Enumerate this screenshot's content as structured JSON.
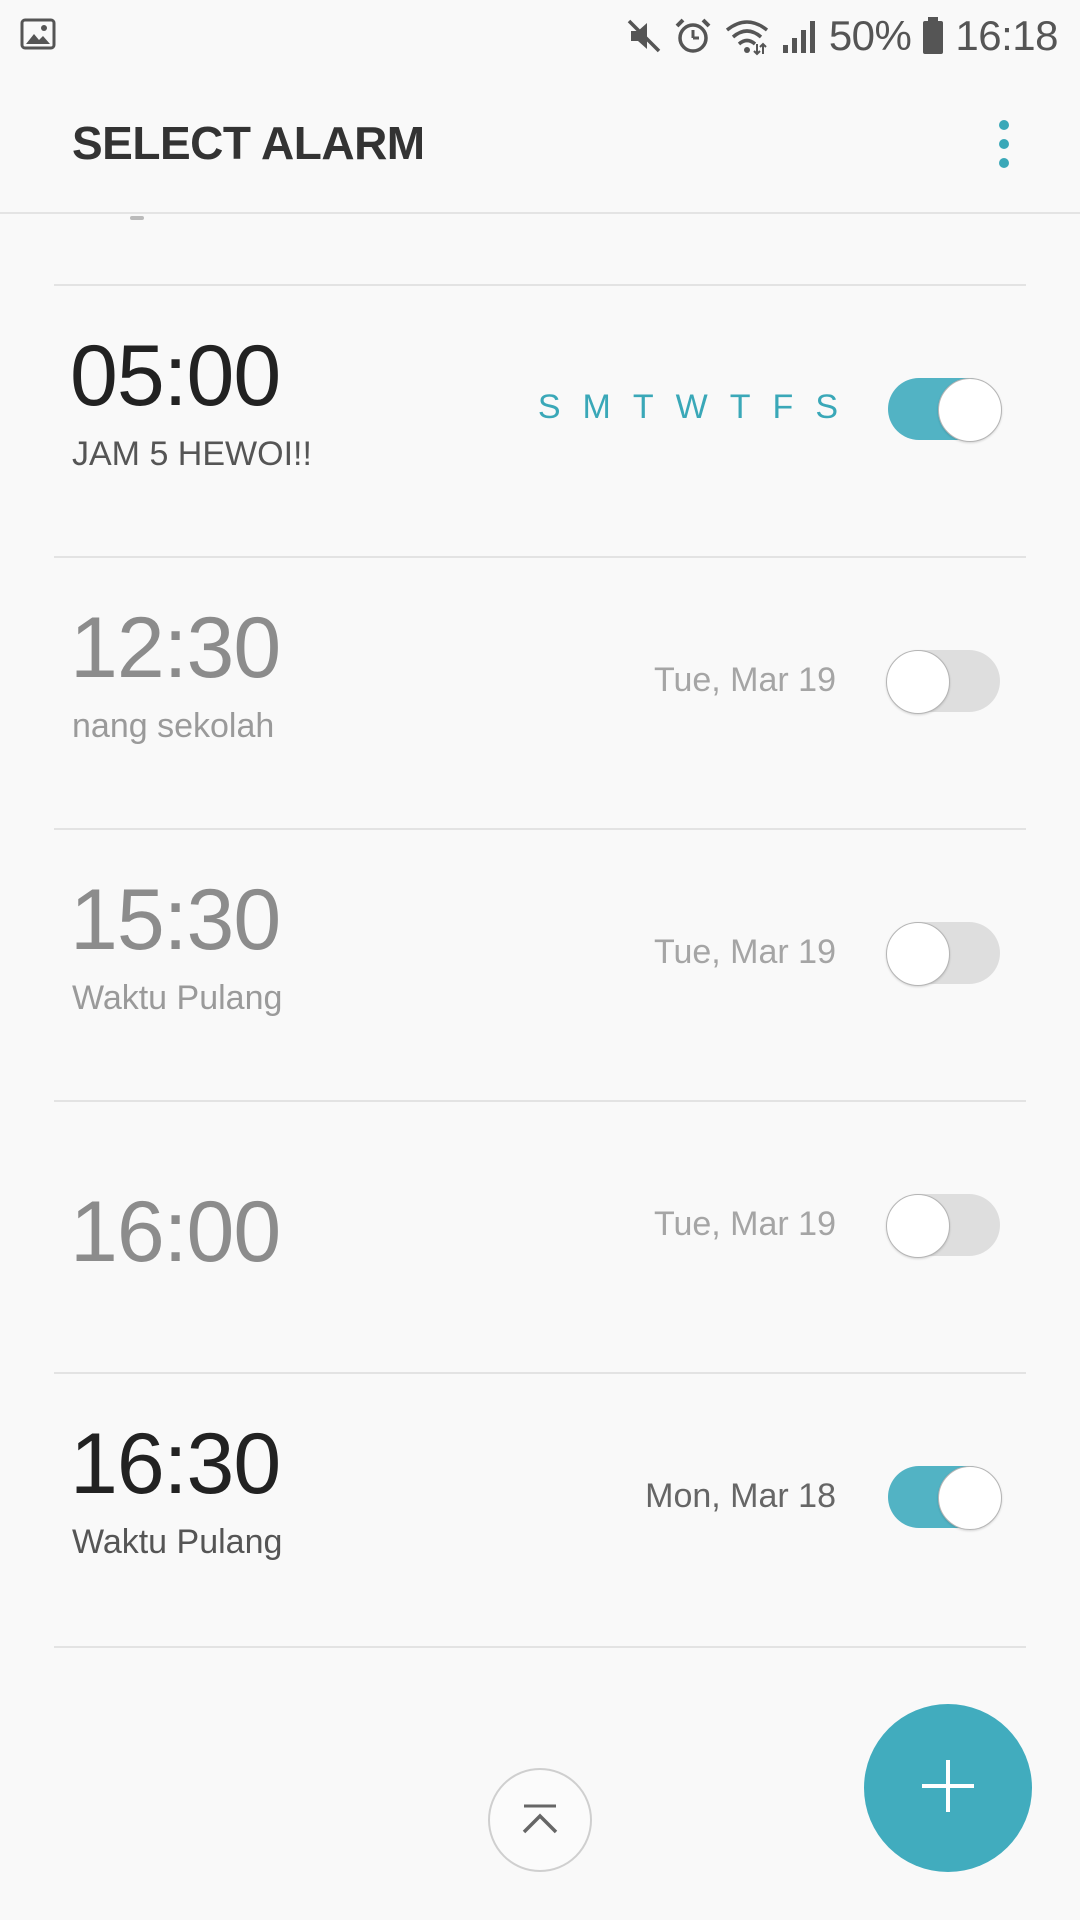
{
  "status_bar": {
    "battery_percent": "50%",
    "time": "16:18",
    "icons": [
      "gallery-icon",
      "mute-icon",
      "alarm-clock-icon",
      "wifi-icon",
      "signal-icon",
      "battery-icon"
    ]
  },
  "app_bar": {
    "title": "SELECT ALARM",
    "menu_icon": "more-vert-icon"
  },
  "alarms": [
    {
      "time": "05:00",
      "label": "JAM 5 HEWOI!!",
      "repeat_days": [
        "S",
        "M",
        "T",
        "W",
        "T",
        "F",
        "S"
      ],
      "date": "",
      "enabled": true
    },
    {
      "time": "12:30",
      "label": "nang sekolah",
      "repeat_days": [],
      "date": "Tue, Mar 19",
      "enabled": false
    },
    {
      "time": "15:30",
      "label": "Waktu Pulang",
      "repeat_days": [],
      "date": "Tue, Mar 19",
      "enabled": false
    },
    {
      "time": "16:00",
      "label": "",
      "repeat_days": [],
      "date": "Tue, Mar 19",
      "enabled": false
    },
    {
      "time": "16:30",
      "label": "Waktu Pulang",
      "repeat_days": [],
      "date": "Mon, Mar 18",
      "enabled": true
    }
  ],
  "actions": {
    "scroll_top_icon": "scroll-to-top-icon",
    "add_icon": "plus-icon"
  },
  "colors": {
    "accent": "#41acbe",
    "toggle_on": "#52b3c4",
    "toggle_off": "#dedede",
    "background": "#f9f9f9"
  }
}
